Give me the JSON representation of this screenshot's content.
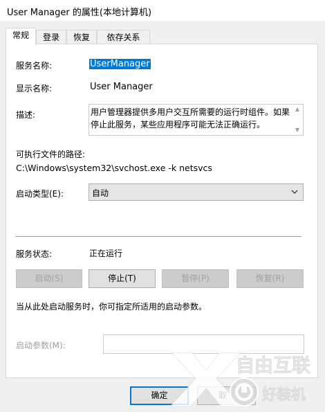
{
  "window": {
    "title": "User Manager 的属性(本地计算机)"
  },
  "tabs": [
    {
      "label": "常规",
      "active": true
    },
    {
      "label": "登录",
      "active": false
    },
    {
      "label": "恢复",
      "active": false
    },
    {
      "label": "依存关系",
      "active": false
    }
  ],
  "general": {
    "service_name_label": "服务名称:",
    "service_name_value": "UserManager",
    "display_name_label": "显示名称:",
    "display_name_value": "User Manager",
    "description_label": "描述:",
    "description_value": "用户管理器提供多用户交互所需要的运行时组件。如果停止此服务，某些应用程序可能无法正确运行。",
    "exe_path_label": "可执行文件的路径:",
    "exe_path_value": "C:\\Windows\\system32\\svchost.exe -k netsvcs",
    "startup_type_label": "启动类型(E):",
    "startup_type_value": "自动",
    "service_status_label": "服务状态:",
    "service_status_value": "正在运行",
    "buttons": {
      "start": "启动(S)",
      "stop": "停止(T)",
      "pause": "暂停(P)",
      "resume": "恢复(R)"
    },
    "hint_text": "当从此处启动服务时，你可指定所适用的启动参数。",
    "start_params_label": "启动参数(M):",
    "start_params_value": ""
  },
  "dialog_buttons": {
    "ok": "确定",
    "cancel": "取"
  },
  "watermarks": [
    {
      "text": "自由互联"
    },
    {
      "text": "好装机"
    }
  ],
  "colors": {
    "selection": "#0078d7",
    "panel_background": "#ffffff",
    "window_background": "#f0f0f0",
    "disabled_text": "#a0a0a0"
  }
}
